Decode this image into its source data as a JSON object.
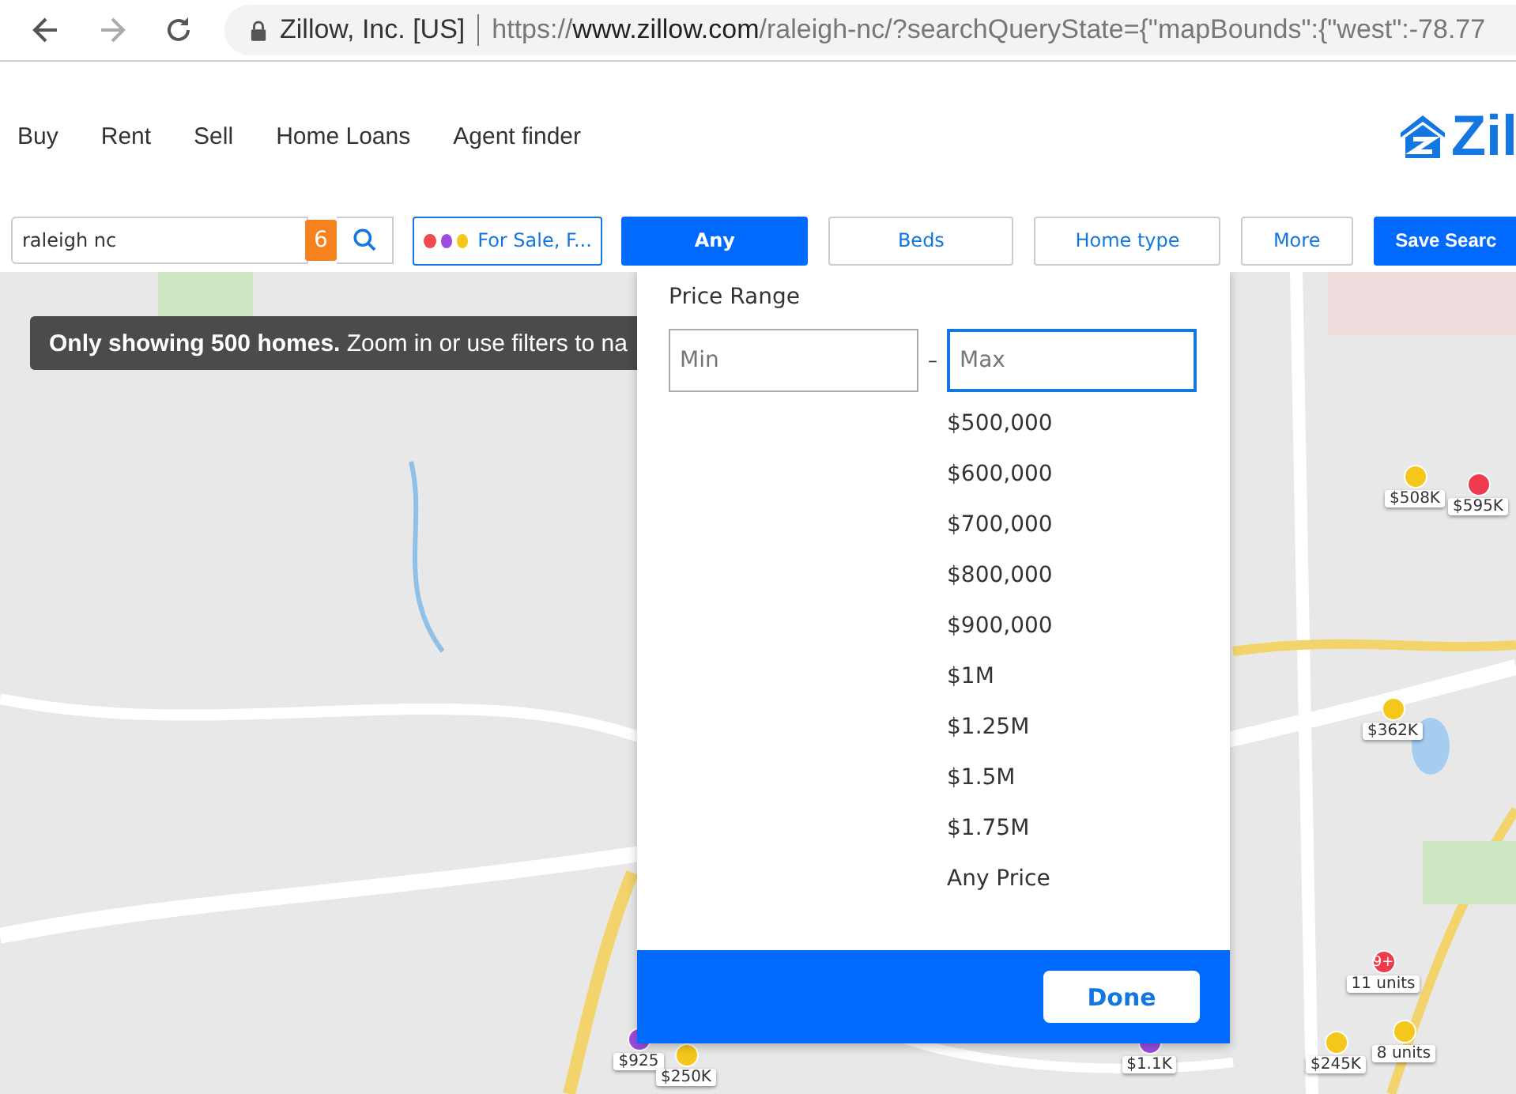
{
  "browser": {
    "site_label": "Zillow, Inc. [US]",
    "url_scheme": "https://",
    "url_host": "www.zillow.com",
    "url_path": "/raleigh-nc/?searchQueryState={\"mapBounds\":{\"west\":-78.77"
  },
  "nav": {
    "items": [
      "Buy",
      "Rent",
      "Sell",
      "Home Loans",
      "Agent finder"
    ],
    "logo_text": "Zil"
  },
  "filters": {
    "search": {
      "value": "raleigh nc",
      "badge": "6"
    },
    "listing_type": {
      "label": "For Sale, F...",
      "dots": [
        {
          "color": "#ef4d4d"
        },
        {
          "color": "#9b4de0"
        },
        {
          "color": "#f5c71a"
        }
      ]
    },
    "buttons": [
      {
        "label": "Any",
        "selected": true
      },
      {
        "label": "Beds",
        "selected": false
      },
      {
        "label": "Home type",
        "selected": false
      },
      {
        "label": "More",
        "selected": false
      }
    ],
    "save": "Save Searc"
  },
  "map": {
    "banner": "**Only showing 500 homes.** Zoom in or use filters to na",
    "pins": [
      {
        "label": "$508K",
        "color": "#f5c71a"
      },
      {
        "label": "$595K",
        "color": "#ef3b4d"
      },
      {
        "label": "$362K",
        "color": "#f5c71a"
      },
      {
        "label": "11 units",
        "color": "#ef3b4d",
        "badge": "9+"
      },
      {
        "label": "$925",
        "color": "#9b4de0"
      },
      {
        "label": "$250K",
        "color": "#f5c71a"
      },
      {
        "label": "$1.1K",
        "color": "#9b4de0"
      },
      {
        "label": "$245K",
        "color": "#f5c71a"
      },
      {
        "label": "8 units",
        "color": "#f5c71a"
      }
    ]
  },
  "price_range": {
    "title": "Price Range",
    "min": {
      "placeholder": "Min",
      "focused": false
    },
    "separator": "–",
    "max": {
      "placeholder": "Max",
      "focused": true
    },
    "options": [
      "$500,000",
      "$600,000",
      "$700,000",
      "$800,000",
      "$900,000",
      "$1M",
      "$1.25M",
      "$1.5M",
      "$1.75M",
      "Any Price"
    ],
    "done": "Done"
  }
}
